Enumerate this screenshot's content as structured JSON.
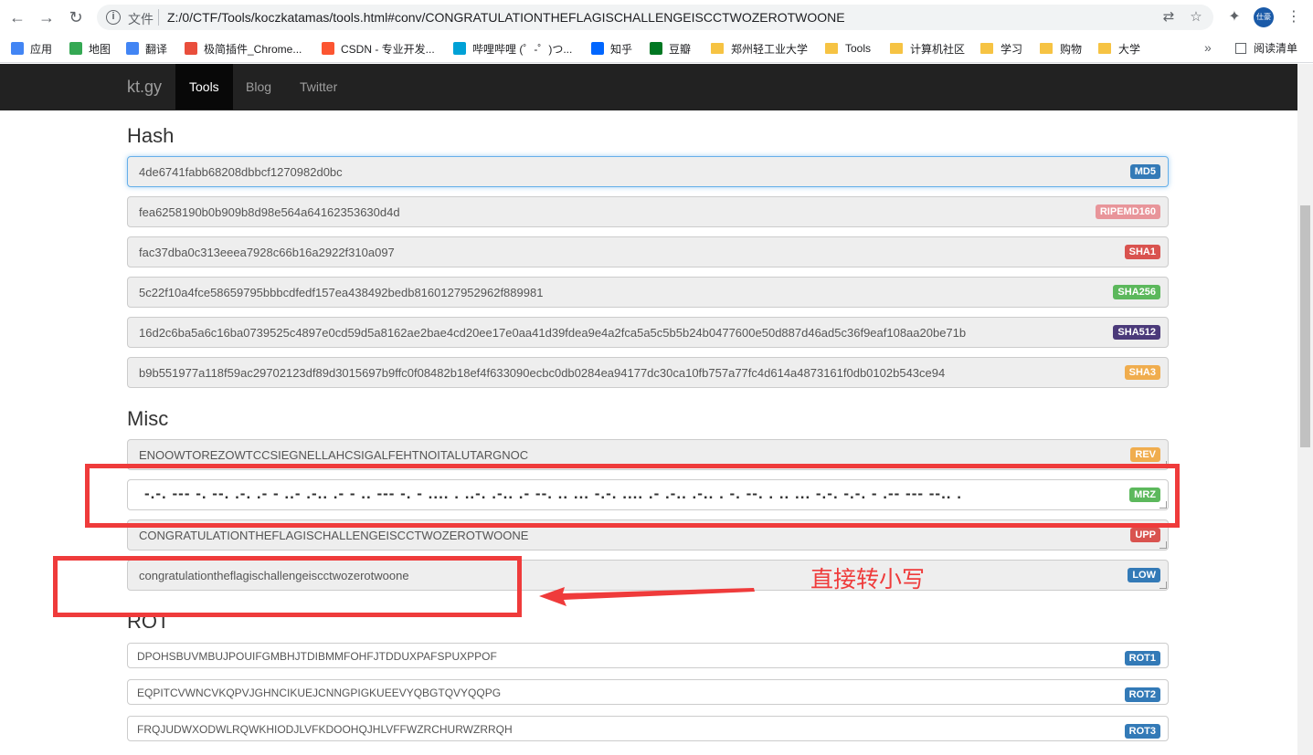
{
  "browser": {
    "file_label": "文件",
    "url": "Z:/0/CTF/Tools/koczkatamas/tools.html#conv/CONGRATULATIONTHEFLAGISCHALLENGEISCCTWOZEROTWOONE",
    "avatar_text": "仕豪",
    "bookmarks": [
      {
        "label": "应用",
        "color": "#4285f4"
      },
      {
        "label": "地图",
        "color": "#34a853"
      },
      {
        "label": "翻译",
        "color": "#4285f4"
      },
      {
        "label": "极简插件_Chrome...",
        "color": "#e94e3c"
      },
      {
        "label": "CSDN - 专业开发...",
        "color": "#fc5531"
      },
      {
        "label": "哔哩哔哩 (゜-゜)つ...",
        "color": "#00a1d6"
      },
      {
        "label": "知乎",
        "color": "#0066ff"
      },
      {
        "label": "豆瓣",
        "color": "#007722"
      },
      {
        "label": "郑州轻工业大学",
        "color": "#f6c343"
      },
      {
        "label": "Tools",
        "color": "#f6c343"
      },
      {
        "label": "计算机社区",
        "color": "#f6c343"
      },
      {
        "label": "学习",
        "color": "#f6c343"
      },
      {
        "label": "购物",
        "color": "#f6c343"
      },
      {
        "label": "大学",
        "color": "#f6c343"
      }
    ],
    "more": "»",
    "reading_list": "阅读清单"
  },
  "navbar": {
    "brand": "kt.gy",
    "items": [
      {
        "label": "Tools",
        "active": true
      },
      {
        "label": "Blog",
        "active": false
      },
      {
        "label": "Twitter",
        "active": false
      }
    ]
  },
  "hash": {
    "title": "Hash",
    "rows": [
      {
        "value": "4de6741fabb68208dbbcf1270982d0bc",
        "label": "MD5",
        "color": "#337ab7"
      },
      {
        "value": "fea6258190b0b909b8d98e564a64162353630d4d",
        "label": "RIPEMD160",
        "color": "#e8959a"
      },
      {
        "value": "fac37dba0c313eeea7928c66b16a2922f310a097",
        "label": "SHA1",
        "color": "#d9534f"
      },
      {
        "value": "5c22f10a4fce58659795bbbcdfedf157ea438492bedb8160127952962f889981",
        "label": "SHA256",
        "color": "#5cb85c"
      },
      {
        "value": "16d2c6ba5a6c16ba0739525c4897e0cd59d5a8162ae2bae4cd20ee17e0aa41d39fdea9e4a2fca5a5c5b5b24b0477600e50d887d46ad5c36f9eaf108aa20be71b",
        "label": "SHA512",
        "color": "#4b3a7a"
      },
      {
        "value": "b9b551977a118f59ac29702123df89d3015697b9ffc0f08482b18ef4f633090ecbc0db0284ea94177dc30ca10fb757a77fc4d614a4873161f0db0102b543ce94",
        "label": "SHA3",
        "color": "#f0ad4e"
      }
    ]
  },
  "misc": {
    "title": "Misc",
    "rows": [
      {
        "value": "ENOOWTOREZOWTCCSIEGNELLAHCSIGALFEHTNOITALUTARGNOC",
        "label": "REV",
        "color": "#f0ad4e"
      },
      {
        "value": "-.-. --- -. --. .-. .- - ..- .-.. .- - .. --- -. - .... . ..-. .-.. .- --. .. ... -.-. .... .- .-.. .-.. . -. --. . .. ... -.-. -.-. - .-- --- --.. .",
        "label": "MRZ",
        "color": "#5cb85c"
      },
      {
        "value": "CONGRATULATIONTHEFLAGISCHALLENGEISCCTWOZEROTWOONE",
        "label": "UPP",
        "color": "#d9534f"
      },
      {
        "value": "congratulationtheflagischallengeiscctwozerotwoone",
        "label": "LOW",
        "color": "#337ab7"
      }
    ]
  },
  "rot": {
    "title": "ROT",
    "rows": [
      {
        "value": "DPOHSBUVMBUJPOUIFGMBHJTDIBMMFOHFJTDDUXPAFSPUXPPOF",
        "label": "ROT1",
        "color": "#337ab7"
      },
      {
        "value": "EQPITCVWNCVKQPVJGHNCIKUEJCNNGPIGKUEEVYQBGTQVYQQPG",
        "label": "ROT2",
        "color": "#337ab7"
      },
      {
        "value": "FRQJUDWXODWLRQWKHIODJLVFKDOOHQJHLVFFWZRCHURWZRRQH",
        "label": "ROT3",
        "color": "#337ab7"
      }
    ]
  },
  "annotation": {
    "text": "直接转小写",
    "color": "#ef3b3b"
  }
}
